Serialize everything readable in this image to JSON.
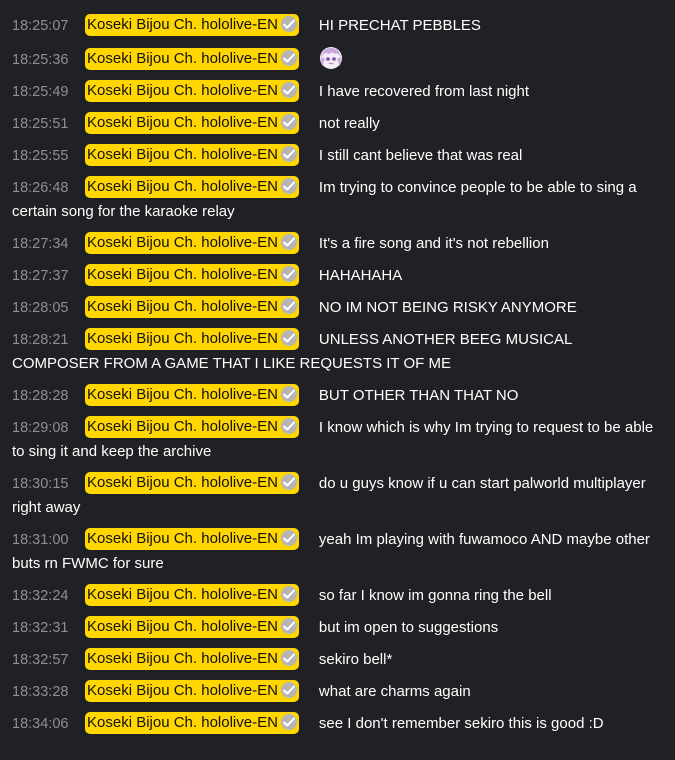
{
  "chat": {
    "messages": [
      {
        "time": "18:25:07",
        "author": "Koseki Bijou Ch. hololive-EN",
        "text": "HI PRECHAT PEBBLES"
      },
      {
        "time": "18:25:36",
        "author": "Koseki Bijou Ch. hololive-EN",
        "text": "",
        "emote": "bijou-face-emote"
      },
      {
        "time": "18:25:49",
        "author": "Koseki Bijou Ch. hololive-EN",
        "text": "I have recovered from last night"
      },
      {
        "time": "18:25:51",
        "author": "Koseki Bijou Ch. hololive-EN",
        "text": "not really"
      },
      {
        "time": "18:25:55",
        "author": "Koseki Bijou Ch. hololive-EN",
        "text": "I still cant believe that was real"
      },
      {
        "time": "18:26:48",
        "author": "Koseki Bijou Ch. hololive-EN",
        "text": "Im trying to convince people to be able to sing a certain song for the karaoke relay"
      },
      {
        "time": "18:27:34",
        "author": "Koseki Bijou Ch. hololive-EN",
        "text": "It's a fire song and it's not rebellion"
      },
      {
        "time": "18:27:37",
        "author": "Koseki Bijou Ch. hololive-EN",
        "text": "HAHAHAHA"
      },
      {
        "time": "18:28:05",
        "author": "Koseki Bijou Ch. hololive-EN",
        "text": "NO IM NOT BEING RISKY ANYMORE"
      },
      {
        "time": "18:28:21",
        "author": "Koseki Bijou Ch. hololive-EN",
        "text": "UNLESS ANOTHER BEEG MUSICAL COMPOSER FROM A GAME THAT I LIKE REQUESTS IT OF ME"
      },
      {
        "time": "18:28:28",
        "author": "Koseki Bijou Ch. hololive-EN",
        "text": "BUT OTHER THAN THAT NO"
      },
      {
        "time": "18:29:08",
        "author": "Koseki Bijou Ch. hololive-EN",
        "text": "I know which is why Im trying to request to be able to sing it and keep the archive"
      },
      {
        "time": "18:30:15",
        "author": "Koseki Bijou Ch. hololive-EN",
        "text": "do u guys know if u can start palworld multiplayer right away"
      },
      {
        "time": "18:31:00",
        "author": "Koseki Bijou Ch. hololive-EN",
        "text": "yeah Im playing with fuwamoco AND maybe other buts rn FWMC for sure"
      },
      {
        "time": "18:32:24",
        "author": "Koseki Bijou Ch. hololive-EN",
        "text": "so far I know im gonna ring the bell"
      },
      {
        "time": "18:32:31",
        "author": "Koseki Bijou Ch. hololive-EN",
        "text": "but im open to suggestions"
      },
      {
        "time": "18:32:57",
        "author": "Koseki Bijou Ch. hololive-EN",
        "text": "sekiro bell*"
      },
      {
        "time": "18:33:28",
        "author": "Koseki Bijou Ch. hololive-EN",
        "text": "what are charms again"
      },
      {
        "time": "18:34:06",
        "author": "Koseki Bijou Ch. hololive-EN",
        "text": "see I don't remember sekiro this is good :D"
      }
    ],
    "colors": {
      "background": "#202124",
      "timestamp": "#8f8f8f",
      "author_highlight": "#ffd600",
      "author_text": "#111111",
      "message_text": "#ffffff",
      "badge": "#b5b5b5"
    },
    "badge_icon": "verified-check-icon"
  }
}
